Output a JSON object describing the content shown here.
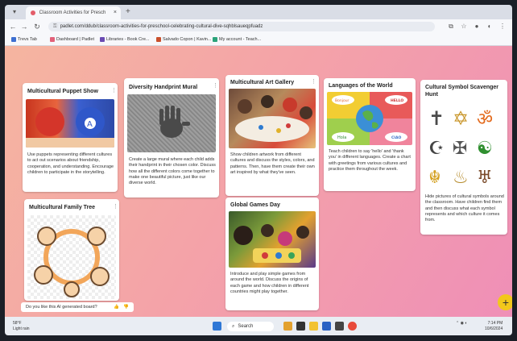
{
  "browser": {
    "tab_title": "Classroom Activities for Presch",
    "tab_close": "×",
    "new_tab": "+",
    "url": "padlet.com/ddub/classroom-activities-for-preschool-celebrating-cultural-dive-sqhblsaueqpfuadz",
    "nav": {
      "back": "←",
      "forward": "→",
      "reload": "↻"
    },
    "bookmarks": [
      {
        "label": "Trevs Tab",
        "color": "#3d6fd1"
      },
      {
        "label": "Dashboard | Padlet",
        "color": "#e2627a"
      },
      {
        "label": "Libraries - Book Cre...",
        "color": "#6a4bb3"
      },
      {
        "label": "Salvado Copon | Kavin...",
        "color": "#c94f2b"
      },
      {
        "label": "My account - Teach...",
        "color": "#2aa37a"
      }
    ]
  },
  "cards": [
    {
      "title": "Multicultural Puppet Show",
      "body": "Use puppets representing different cultures to act out scenarios about friendship, cooperation, and understanding. Encourage children to participate in the storytelling."
    },
    {
      "title": "Diversity Handprint Mural",
      "body": "Create a large mural where each child adds their handprint in their chosen color. Discuss how all the different colors come together to make one beautiful picture, just like our diverse world."
    },
    {
      "title": "Multicultural Art Gallery",
      "body": "Show children artwork from different cultures and discuss the styles, colors, and patterns. Then, have them create their own art inspired by what they've seen."
    },
    {
      "title": "Languages of the World",
      "body": "Teach children to say 'hello' and 'thank you' in different languages. Create a chart with greetings from various cultures and practice them throughout the week.",
      "bubbles": [
        "Bonjour",
        "HELLO",
        "Hola",
        "CIAO"
      ]
    },
    {
      "title": "Cultural Symbol Scavenger Hunt",
      "body": "Hide pictures of cultural symbols around the classroom. Have children find them and then discuss what each symbol represents and which culture it comes from.",
      "symbols": [
        "✝",
        "✡",
        "ॐ",
        "☪",
        "✠",
        "☯",
        "☬",
        "♨",
        "♅"
      ]
    },
    {
      "title": "Multicultural Family Tree",
      "body": ""
    },
    {
      "title": "Global Games Day",
      "body": "Introduce and play simple games from around the world. Discuss the origins of each game and how children in different countries might play together."
    }
  ],
  "ai_prompt": {
    "text": "Do you like this AI generated board?",
    "up": "👍",
    "down": "👎"
  },
  "fab_label": "+",
  "taskbar": {
    "weather": {
      "temp": "58°F",
      "cond": "Light rain"
    },
    "search_label": "Search",
    "time": "7:14 PM",
    "date": "10/6/2024"
  },
  "colors": {
    "accent": "#f2c81b",
    "board_bg": "#f4a3a8"
  }
}
